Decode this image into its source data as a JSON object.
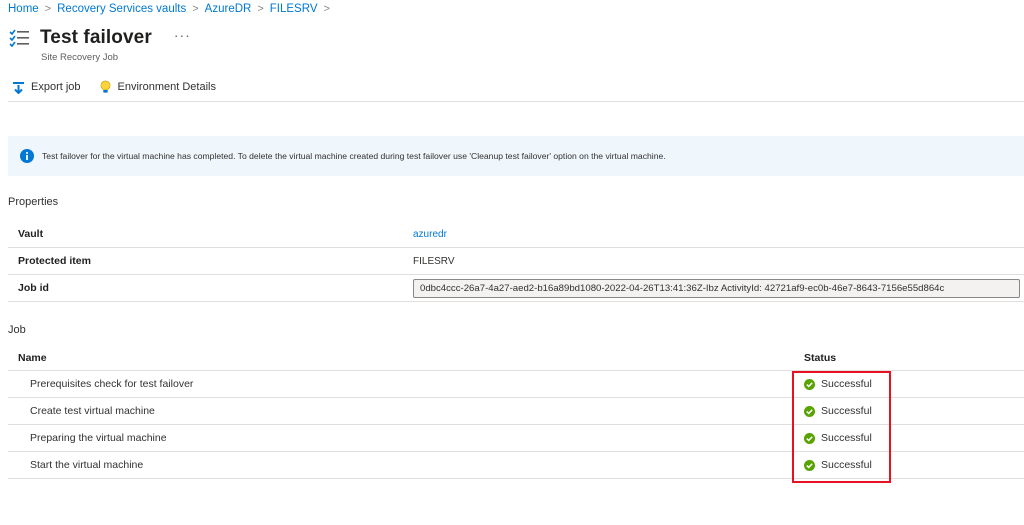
{
  "breadcrumb": [
    "Home",
    "Recovery Services vaults",
    "AzureDR",
    "FILESRV"
  ],
  "header": {
    "title": "Test failover",
    "subtitle": "Site Recovery Job",
    "more": "···"
  },
  "toolbar": {
    "export_label": "Export job",
    "env_label": "Environment Details"
  },
  "banner": {
    "text": "Test failover for the virtual machine has completed. To delete the virtual machine created during test failover use 'Cleanup test failover' option on the virtual machine."
  },
  "properties": {
    "label": "Properties",
    "rows": [
      {
        "key": "Vault",
        "value": "azuredr"
      },
      {
        "key": "Protected item",
        "value": "FILESRV"
      },
      {
        "key": "Job id",
        "value": "0dbc4ccc-26a7-4a27-aed2-b16a89bd1080-2022-04-26T13:41:36Z-Ibz ActivityId: 42721af9-ec0b-46e7-8643-7156e55d864c"
      }
    ]
  },
  "job": {
    "label": "Job",
    "columns": {
      "name": "Name",
      "status": "Status"
    },
    "rows": [
      {
        "name": "Prerequisites check for test failover",
        "status": "Successful"
      },
      {
        "name": "Create test virtual machine",
        "status": "Successful"
      },
      {
        "name": "Preparing the virtual machine",
        "status": "Successful"
      },
      {
        "name": "Start the virtual machine",
        "status": "Successful"
      }
    ]
  },
  "colors": {
    "accent": "#0078d4",
    "success": "#57a300",
    "highlight": "#e81123",
    "banner_bg": "#eff6fc"
  },
  "icons": {
    "title": "job-list-icon",
    "export": "export-arrow-icon",
    "env": "lightbulb-icon",
    "banner": "info-icon",
    "status": "success-check-icon"
  }
}
